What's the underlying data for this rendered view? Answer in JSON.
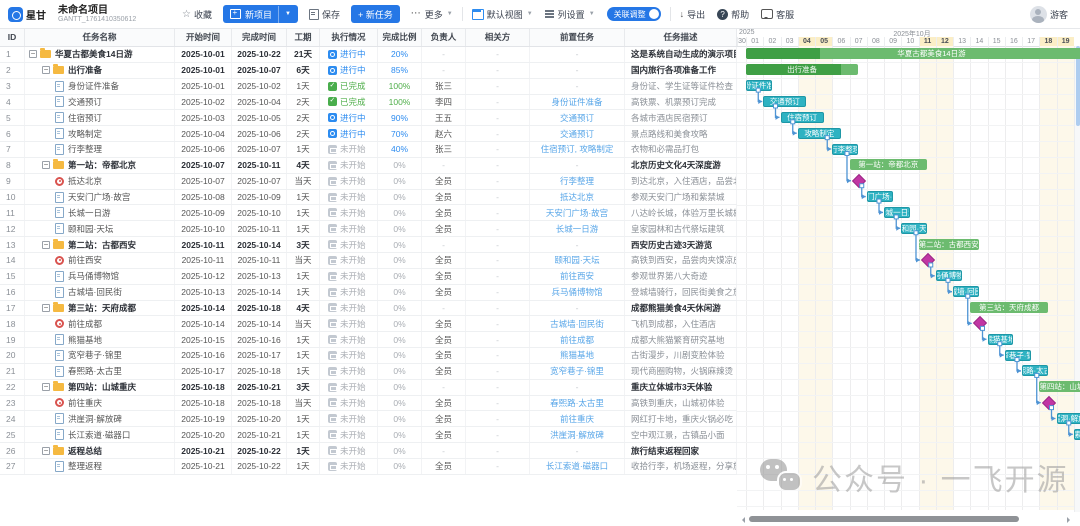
{
  "toolbar": {
    "logo_text": "星甘",
    "project_title": "未命名项目",
    "project_id": "GANTT_1761410350612",
    "favorite_label": "收藏",
    "new_project_label": "新项目",
    "save_label": "保存",
    "new_task_label": "+ 新任务",
    "more_label": "更多",
    "default_view_label": "默认视图",
    "column_settings_label": "列设置",
    "link_adjust_label": "关联调整",
    "export_label": "导出",
    "help_label": "帮助",
    "support_label": "客服",
    "user_label": "游客"
  },
  "colors": {
    "accent_blue": "#2577e6",
    "bar_group_light": "#6cbb6f",
    "bar_group_dark": "#3f9f45",
    "bar_task": "#2eb2c2",
    "milestone": "#c136a4",
    "connector": "#4f94d4",
    "weekend_bg": "#fdf8ea",
    "status_in_progress": "#2d8cf0",
    "status_done": "#4fae4a",
    "status_not_started": "#a9adb3"
  },
  "statuses": {
    "ip": {
      "label": "进行中"
    },
    "done": {
      "label": "已完成"
    },
    "ns": {
      "label": "未开始"
    }
  },
  "table": {
    "columns": [
      "ID",
      "任务名称",
      "开始时间",
      "完成时间",
      "工期",
      "执行情况",
      "完成比例",
      "负责人",
      "相关方",
      "前置任务",
      "任务描述"
    ],
    "rows": [
      {
        "id": "1",
        "name": "华夏古都美食14日游",
        "type": "group",
        "level": 0,
        "start": "2025-10-01",
        "end": "2025-10-22",
        "dur": "21天",
        "status": "ip",
        "pct": "20%",
        "owner": "-",
        "party": "-",
        "pred": "-",
        "desc": "这是系统自动生成的演示项目，可",
        "gs": 1,
        "ge": 22,
        "gp": 20
      },
      {
        "id": "2",
        "name": "出行准备",
        "type": "group",
        "level": 1,
        "start": "2025-10-01",
        "end": "2025-10-07",
        "dur": "6天",
        "status": "ip",
        "pct": "85%",
        "owner": "-",
        "party": "-",
        "pred": "-",
        "desc": "国内旅行各项准备工作",
        "gs": 1,
        "ge": 7,
        "gp": 85
      },
      {
        "id": "3",
        "name": "身份证件准备",
        "type": "task",
        "level": 2,
        "start": "2025-10-01",
        "end": "2025-10-02",
        "dur": "1天",
        "status": "done",
        "pct": "100%",
        "owner": "张三",
        "party": "-",
        "pred": "-",
        "desc": "身份证、学生证等证件检查",
        "gs": 1,
        "ge": 2
      },
      {
        "id": "4",
        "name": "交通预订",
        "type": "task",
        "level": 2,
        "start": "2025-10-02",
        "end": "2025-10-04",
        "dur": "2天",
        "status": "done",
        "pct": "100%",
        "owner": "李四",
        "party": "-",
        "pred": "身份证件准备",
        "desc": "高铁票、机票预订完成",
        "gs": 2,
        "ge": 4
      },
      {
        "id": "5",
        "name": "住宿预订",
        "type": "task",
        "level": 2,
        "start": "2025-10-03",
        "end": "2025-10-05",
        "dur": "2天",
        "status": "ip",
        "pct": "90%",
        "owner": "王五",
        "party": "-",
        "pred": "交通预订",
        "desc": "各城市酒店民宿预订",
        "gs": 3,
        "ge": 5
      },
      {
        "id": "6",
        "name": "攻略制定",
        "type": "task",
        "level": 2,
        "start": "2025-10-04",
        "end": "2025-10-06",
        "dur": "2天",
        "status": "ip",
        "pct": "70%",
        "owner": "赵六",
        "party": "-",
        "pred": "交通预订",
        "desc": "景点路线和美食攻略",
        "gs": 4,
        "ge": 6
      },
      {
        "id": "7",
        "name": "行李整理",
        "type": "task",
        "level": 2,
        "start": "2025-10-06",
        "end": "2025-10-07",
        "dur": "1天",
        "status": "ns",
        "pct": "40%",
        "owner": "张三",
        "party": "-",
        "pred": "住宿预订, 攻略制定",
        "desc": "衣物和必需品打包",
        "gs": 6,
        "ge": 7
      },
      {
        "id": "8",
        "name": "第一站：帝都北京",
        "type": "group",
        "level": 1,
        "start": "2025-10-07",
        "end": "2025-10-11",
        "dur": "4天",
        "status": "ns",
        "pct": "0%",
        "owner": "-",
        "party": "-",
        "pred": "-",
        "desc": "北京历史文化4天深度游",
        "gs": 7,
        "ge": 11,
        "gp": 0
      },
      {
        "id": "9",
        "name": "抵达北京",
        "type": "milestone",
        "level": 2,
        "start": "2025-10-07",
        "end": "2025-10-07",
        "dur": "当天",
        "status": "ns",
        "pct": "0%",
        "owner": "全员",
        "party": "-",
        "pred": "行李整理",
        "desc": "到达北京，入住酒店，品尝北京烤",
        "gs": 7,
        "ge": 7
      },
      {
        "id": "10",
        "name": "天安门广场·故宫",
        "type": "task",
        "level": 2,
        "start": "2025-10-08",
        "end": "2025-10-09",
        "dur": "1天",
        "status": "ns",
        "pct": "0%",
        "owner": "全员",
        "party": "-",
        "pred": "抵达北京",
        "desc": "参观天安门广场和紫禁城",
        "gs": 8,
        "ge": 9
      },
      {
        "id": "11",
        "name": "长城一日游",
        "type": "task",
        "level": 2,
        "start": "2025-10-09",
        "end": "2025-10-10",
        "dur": "1天",
        "status": "ns",
        "pct": "0%",
        "owner": "全员",
        "party": "-",
        "pred": "天安门广场·故宫",
        "desc": "八达岭长城，体验万里长城雄伟",
        "gs": 9,
        "ge": 10
      },
      {
        "id": "12",
        "name": "颐和园·天坛",
        "type": "task",
        "level": 2,
        "start": "2025-10-10",
        "end": "2025-10-11",
        "dur": "1天",
        "status": "ns",
        "pct": "0%",
        "owner": "全员",
        "party": "-",
        "pred": "长城一日游",
        "desc": "皇家园林和古代祭坛建筑",
        "gs": 10,
        "ge": 11
      },
      {
        "id": "13",
        "name": "第二站：古都西安",
        "type": "group",
        "level": 1,
        "start": "2025-10-11",
        "end": "2025-10-14",
        "dur": "3天",
        "status": "ns",
        "pct": "0%",
        "owner": "-",
        "party": "-",
        "pred": "-",
        "desc": "西安历史古迹3天游览",
        "gs": 11,
        "ge": 14,
        "gp": 0
      },
      {
        "id": "14",
        "name": "前往西安",
        "type": "milestone",
        "level": 2,
        "start": "2025-10-11",
        "end": "2025-10-11",
        "dur": "当天",
        "status": "ns",
        "pct": "0%",
        "owner": "全员",
        "party": "-",
        "pred": "颐和园·天坛",
        "desc": "高铁到西安，品尝肉夹馍凉皮",
        "gs": 11,
        "ge": 11
      },
      {
        "id": "15",
        "name": "兵马俑博物馆",
        "type": "task",
        "level": 2,
        "start": "2025-10-12",
        "end": "2025-10-13",
        "dur": "1天",
        "status": "ns",
        "pct": "0%",
        "owner": "全员",
        "party": "-",
        "pred": "前往西安",
        "desc": "参观世界第八大奇迹",
        "gs": 12,
        "ge": 13
      },
      {
        "id": "16",
        "name": "古城墙·回民街",
        "type": "task",
        "level": 2,
        "start": "2025-10-13",
        "end": "2025-10-14",
        "dur": "1天",
        "status": "ns",
        "pct": "0%",
        "owner": "全员",
        "party": "-",
        "pred": "兵马俑博物馆",
        "desc": "登城墙骑行，回民街美食之旅",
        "gs": 13,
        "ge": 14
      },
      {
        "id": "17",
        "name": "第三站：天府成都",
        "type": "group",
        "level": 1,
        "start": "2025-10-14",
        "end": "2025-10-18",
        "dur": "4天",
        "status": "ns",
        "pct": "0%",
        "owner": "-",
        "party": "-",
        "pred": "-",
        "desc": "成都熊猫美食4天休闲游",
        "gs": 14,
        "ge": 18,
        "gp": 0
      },
      {
        "id": "18",
        "name": "前往成都",
        "type": "milestone",
        "level": 2,
        "start": "2025-10-14",
        "end": "2025-10-14",
        "dur": "当天",
        "status": "ns",
        "pct": "0%",
        "owner": "全员",
        "party": "-",
        "pred": "古城墙·回民街",
        "desc": "飞机到成都，入住酒店",
        "gs": 14,
        "ge": 14
      },
      {
        "id": "19",
        "name": "熊猫基地",
        "type": "task",
        "level": 2,
        "start": "2025-10-15",
        "end": "2025-10-16",
        "dur": "1天",
        "status": "ns",
        "pct": "0%",
        "owner": "全员",
        "party": "-",
        "pred": "前往成都",
        "desc": "成都大熊猫繁育研究基地",
        "gs": 15,
        "ge": 16
      },
      {
        "id": "20",
        "name": "宽窄巷子·锦里",
        "type": "task",
        "level": 2,
        "start": "2025-10-16",
        "end": "2025-10-17",
        "dur": "1天",
        "status": "ns",
        "pct": "0%",
        "owner": "全员",
        "party": "-",
        "pred": "熊猫基地",
        "desc": "古街漫步，川剧变脸体验",
        "gs": 16,
        "ge": 17
      },
      {
        "id": "21",
        "name": "春熙路·太古里",
        "type": "task",
        "level": 2,
        "start": "2025-10-17",
        "end": "2025-10-18",
        "dur": "1天",
        "status": "ns",
        "pct": "0%",
        "owner": "全员",
        "party": "-",
        "pred": "宽窄巷子·锦里",
        "desc": "现代商圈购物，火锅麻辣烫",
        "gs": 17,
        "ge": 18
      },
      {
        "id": "22",
        "name": "第四站：山城重庆",
        "type": "group",
        "level": 1,
        "start": "2025-10-18",
        "end": "2025-10-21",
        "dur": "3天",
        "status": "ns",
        "pct": "0%",
        "owner": "-",
        "party": "-",
        "pred": "-",
        "desc": "重庆立体城市3天体验",
        "gs": 18,
        "ge": 21,
        "gp": 0
      },
      {
        "id": "23",
        "name": "前往重庆",
        "type": "milestone",
        "level": 2,
        "start": "2025-10-18",
        "end": "2025-10-18",
        "dur": "当天",
        "status": "ns",
        "pct": "0%",
        "owner": "全员",
        "party": "-",
        "pred": "春熙路·太古里",
        "desc": "高铁到重庆，山城初体验",
        "gs": 18,
        "ge": 18
      },
      {
        "id": "24",
        "name": "洪崖洞·解放碑",
        "type": "task",
        "level": 2,
        "start": "2025-10-19",
        "end": "2025-10-20",
        "dur": "1天",
        "status": "ns",
        "pct": "0%",
        "owner": "全员",
        "party": "-",
        "pred": "前往重庆",
        "desc": "网红打卡地，重庆火锅必吃",
        "gs": 19,
        "ge": 20
      },
      {
        "id": "25",
        "name": "长江索道·磁器口",
        "type": "task",
        "level": 2,
        "start": "2025-10-20",
        "end": "2025-10-21",
        "dur": "1天",
        "status": "ns",
        "pct": "0%",
        "owner": "全员",
        "party": "-",
        "pred": "洪崖洞·解放碑",
        "desc": "空中观江景，古镇品小面",
        "gs": 20,
        "ge": 21
      },
      {
        "id": "26",
        "name": "返程总结",
        "type": "group",
        "level": 1,
        "start": "2025-10-21",
        "end": "2025-10-22",
        "dur": "1天",
        "status": "ns",
        "pct": "0%",
        "owner": "-",
        "party": "-",
        "pred": "-",
        "desc": "旅行结束返程回家",
        "gs": 21,
        "ge": 22,
        "gp": 0
      },
      {
        "id": "27",
        "name": "整理返程",
        "type": "task",
        "level": 2,
        "start": "2025-10-21",
        "end": "2025-10-22",
        "dur": "1天",
        "status": "ns",
        "pct": "0%",
        "owner": "全员",
        "party": "-",
        "pred": "长江索道·磁器口",
        "desc": "收拾行李，机场返程，分享旅行回",
        "gs": 21,
        "ge": 22
      }
    ]
  },
  "gantt": {
    "year_label": "2025",
    "month_label": "2025年10月",
    "days": [
      "30",
      "01",
      "02",
      "03",
      "04",
      "05",
      "06",
      "07",
      "08",
      "09",
      "10",
      "11",
      "12",
      "13",
      "14",
      "15",
      "16",
      "17",
      "18",
      "19"
    ],
    "weekend_days": [
      "04",
      "05",
      "11",
      "12",
      "18",
      "19"
    ],
    "links": [
      [
        3,
        4
      ],
      [
        4,
        5
      ],
      [
        5,
        6
      ],
      [
        6,
        7
      ],
      [
        7,
        9
      ],
      [
        9,
        10
      ],
      [
        10,
        11
      ],
      [
        11,
        12
      ],
      [
        12,
        14
      ],
      [
        14,
        15
      ],
      [
        15,
        16
      ],
      [
        16,
        18
      ],
      [
        18,
        19
      ],
      [
        19,
        20
      ],
      [
        20,
        21
      ],
      [
        21,
        23
      ],
      [
        23,
        24
      ],
      [
        24,
        25
      ],
      [
        25,
        27
      ]
    ]
  },
  "watermark": {
    "text": "公众号 · 一飞开源"
  }
}
